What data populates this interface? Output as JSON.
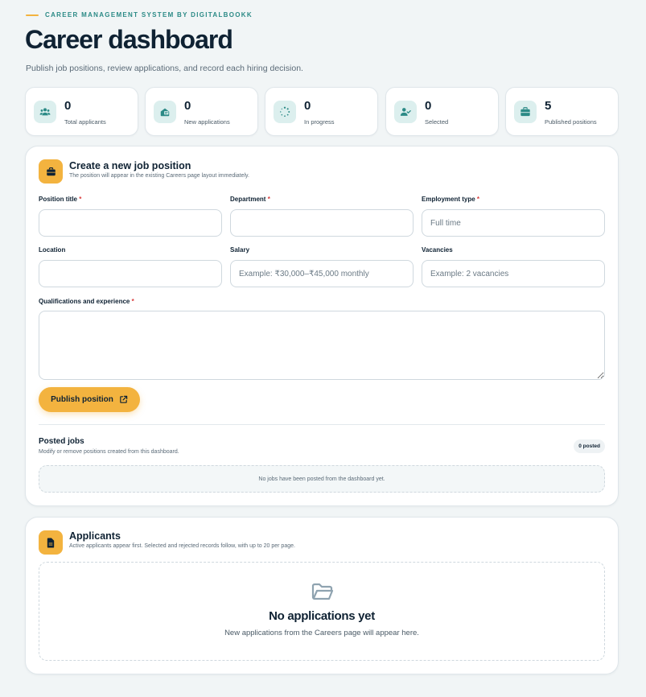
{
  "header": {
    "eyebrow": "CAREER MANAGEMENT SYSTEM BY DIGITALBOOKK",
    "title": "Career dashboard",
    "subtitle": "Publish job positions, review applications, and record each hiring decision."
  },
  "stats": [
    {
      "value": "0",
      "label": "Total applicants",
      "icon": "users-icon"
    },
    {
      "value": "0",
      "label": "New applications",
      "icon": "inbox-icon"
    },
    {
      "value": "0",
      "label": "In progress",
      "icon": "spinner-icon"
    },
    {
      "value": "0",
      "label": "Selected",
      "icon": "user-check-icon"
    },
    {
      "value": "5",
      "label": "Published positions",
      "icon": "briefcase-icon"
    }
  ],
  "create_form": {
    "title": "Create a new job position",
    "description": "The position will appear in the existing Careers page layout immediately.",
    "fields": {
      "position_title": {
        "label": "Position title",
        "required": "*",
        "value": "",
        "placeholder": ""
      },
      "department": {
        "label": "Department",
        "required": "*",
        "value": "",
        "placeholder": ""
      },
      "employment_type": {
        "label": "Employment type",
        "required": "*",
        "value": "",
        "placeholder": "Full time"
      },
      "location": {
        "label": "Location",
        "value": "",
        "placeholder": ""
      },
      "salary": {
        "label": "Salary",
        "value": "",
        "placeholder": "Example: ₹30,000–₹45,000 monthly"
      },
      "vacancies": {
        "label": "Vacancies",
        "value": "",
        "placeholder": "Example: 2 vacancies"
      },
      "qualifications": {
        "label": "Qualifications and experience",
        "required": "*",
        "value": "",
        "placeholder": ""
      }
    },
    "publish_label": "Publish position"
  },
  "posted_jobs": {
    "title": "Posted jobs",
    "description": "Modify or remove positions created from this dashboard.",
    "badge": "0 posted",
    "empty_text": "No jobs have been posted from the dashboard yet."
  },
  "applicants": {
    "title": "Applicants",
    "description": "Active applicants appear first. Selected and rejected records follow, with up to 20 per page.",
    "empty_title": "No applications yet",
    "empty_text": "New applications from the Careers page will appear here."
  },
  "colors": {
    "accent": "#f3b33f",
    "teal": "#2b8a86",
    "icon_bg": "#dcefee",
    "text": "#0f2233",
    "required": "#d93b3b"
  }
}
